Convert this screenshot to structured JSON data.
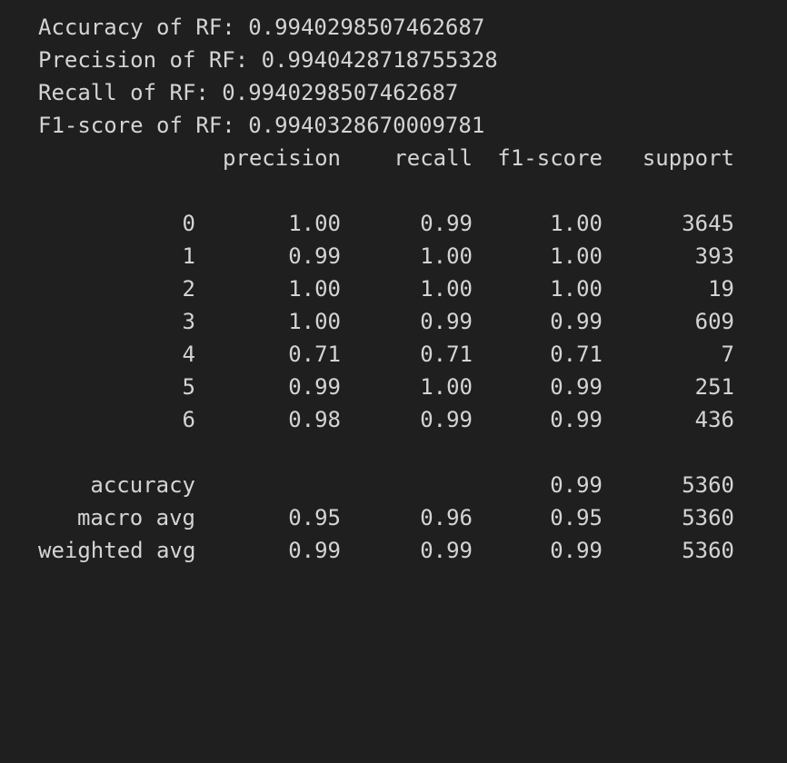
{
  "metrics": [
    {
      "label": "Accuracy of RF: ",
      "value": "0.9940298507462687"
    },
    {
      "label": "Precision of RF: ",
      "value": "0.9940428718755328"
    },
    {
      "label": "Recall of RF: ",
      "value": "0.9940298507462687"
    },
    {
      "label": "F1-score of RF: ",
      "value": "0.9940328670009781"
    }
  ],
  "report": {
    "headers": {
      "precision": "precision",
      "recall": "recall",
      "f1": "f1-score",
      "support": "support"
    },
    "classes": [
      {
        "label": "0",
        "precision": "1.00",
        "recall": "0.99",
        "f1": "1.00",
        "support": "3645"
      },
      {
        "label": "1",
        "precision": "0.99",
        "recall": "1.00",
        "f1": "1.00",
        "support": "393"
      },
      {
        "label": "2",
        "precision": "1.00",
        "recall": "1.00",
        "f1": "1.00",
        "support": "19"
      },
      {
        "label": "3",
        "precision": "1.00",
        "recall": "0.99",
        "f1": "0.99",
        "support": "609"
      },
      {
        "label": "4",
        "precision": "0.71",
        "recall": "0.71",
        "f1": "0.71",
        "support": "7"
      },
      {
        "label": "5",
        "precision": "0.99",
        "recall": "1.00",
        "f1": "0.99",
        "support": "251"
      },
      {
        "label": "6",
        "precision": "0.98",
        "recall": "0.99",
        "f1": "0.99",
        "support": "436"
      }
    ],
    "accuracy": {
      "label": "accuracy",
      "f1": "0.99",
      "support": "5360"
    },
    "macro_avg": {
      "label": "macro avg",
      "precision": "0.95",
      "recall": "0.96",
      "f1": "0.95",
      "support": "5360"
    },
    "weighted_avg": {
      "label": "weighted avg",
      "precision": "0.99",
      "recall": "0.99",
      "f1": "0.99",
      "support": "5360"
    }
  },
  "colors": {
    "background": "#1f1f1f",
    "text": "#d4d4d4"
  }
}
